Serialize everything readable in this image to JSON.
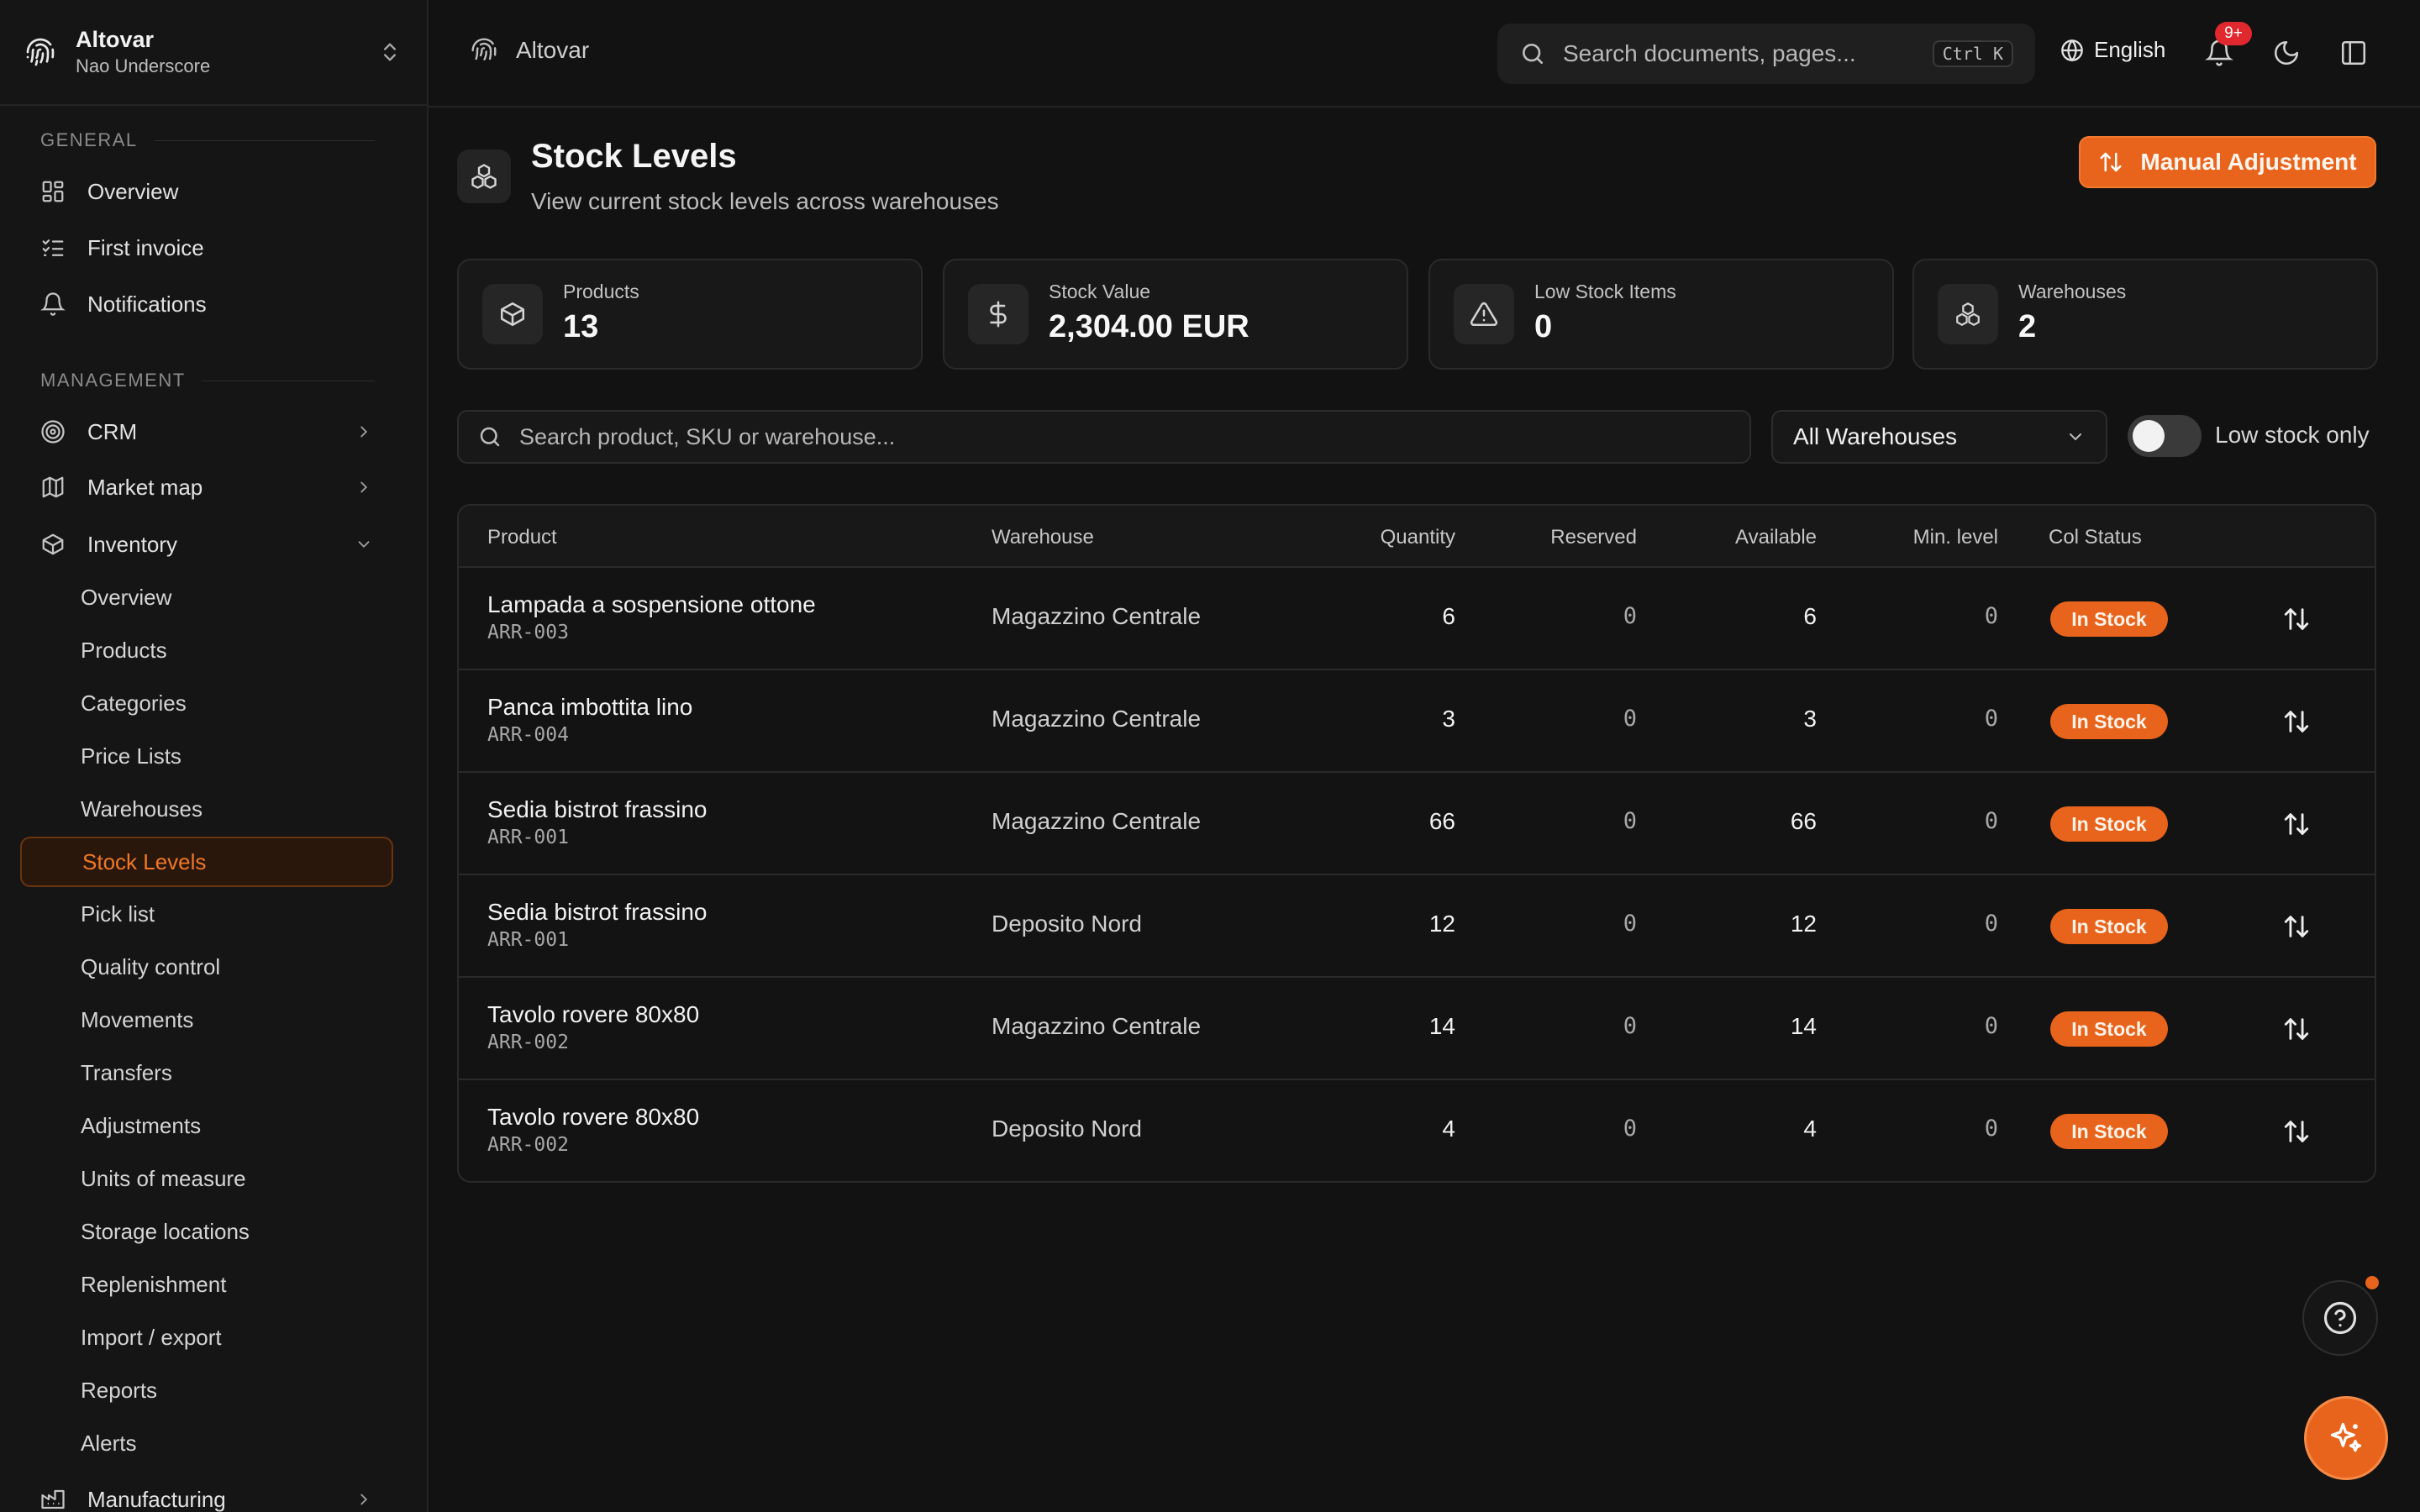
{
  "org": {
    "name": "Altovar",
    "user": "Nao Underscore"
  },
  "sidebar": {
    "general_label": "GENERAL",
    "general": [
      {
        "label": "Overview",
        "icon": "dashboard-icon"
      },
      {
        "label": "First invoice",
        "icon": "checklist-icon"
      },
      {
        "label": "Notifications",
        "icon": "bell-icon"
      }
    ],
    "management_label": "MANAGEMENT",
    "management": [
      {
        "label": "CRM",
        "icon": "target-icon"
      },
      {
        "label": "Market map",
        "icon": "map-icon"
      },
      {
        "label": "Inventory",
        "icon": "box-icon"
      }
    ],
    "inventory_sub": [
      "Overview",
      "Products",
      "Categories",
      "Price Lists",
      "Warehouses",
      "Stock Levels",
      "Pick list",
      "Quality control",
      "Movements",
      "Transfers",
      "Adjustments",
      "Units of measure",
      "Storage locations",
      "Replenishment",
      "Import / export",
      "Reports",
      "Alerts"
    ],
    "active_sub": "Stock Levels",
    "manufacturing": "Manufacturing"
  },
  "topbar": {
    "breadcrumb": "Altovar",
    "search_placeholder": "Search documents, pages...",
    "shortcut": "Ctrl K",
    "language": "English",
    "notification_badge": "9+"
  },
  "page": {
    "title": "Stock Levels",
    "subtitle": "View current stock levels across warehouses",
    "action": "Manual Adjustment"
  },
  "stats": [
    {
      "label": "Products",
      "value": "13",
      "icon": "package-icon"
    },
    {
      "label": "Stock Value",
      "value": "2,304.00 EUR",
      "icon": "dollar-icon"
    },
    {
      "label": "Low Stock Items",
      "value": "0",
      "icon": "warning-icon"
    },
    {
      "label": "Warehouses",
      "value": "2",
      "icon": "boxes-icon"
    }
  ],
  "filters": {
    "search_placeholder": "Search product, SKU or warehouse...",
    "warehouse": "All Warehouses",
    "low_stock_label": "Low stock only",
    "low_stock_on": false
  },
  "table": {
    "headers": [
      "Product",
      "Warehouse",
      "Quantity",
      "Reserved",
      "Available",
      "Min. level",
      "Col Status"
    ],
    "rows": [
      {
        "product": "Lampada a sospensione ottone",
        "sku": "ARR-003",
        "warehouse": "Magazzino Centrale",
        "quantity": "6",
        "reserved": "0",
        "available": "6",
        "min": "0",
        "status": "In Stock"
      },
      {
        "product": "Panca imbottita lino",
        "sku": "ARR-004",
        "warehouse": "Magazzino Centrale",
        "quantity": "3",
        "reserved": "0",
        "available": "3",
        "min": "0",
        "status": "In Stock"
      },
      {
        "product": "Sedia bistrot frassino",
        "sku": "ARR-001",
        "warehouse": "Magazzino Centrale",
        "quantity": "66",
        "reserved": "0",
        "available": "66",
        "min": "0",
        "status": "In Stock"
      },
      {
        "product": "Sedia bistrot frassino",
        "sku": "ARR-001",
        "warehouse": "Deposito Nord",
        "quantity": "12",
        "reserved": "0",
        "available": "12",
        "min": "0",
        "status": "In Stock"
      },
      {
        "product": "Tavolo rovere 80x80",
        "sku": "ARR-002",
        "warehouse": "Magazzino Centrale",
        "quantity": "14",
        "reserved": "0",
        "available": "14",
        "min": "0",
        "status": "In Stock"
      },
      {
        "product": "Tavolo rovere 80x80",
        "sku": "ARR-002",
        "warehouse": "Deposito Nord",
        "quantity": "4",
        "reserved": "0",
        "available": "4",
        "min": "0",
        "status": "In Stock"
      }
    ]
  },
  "colors": {
    "accent": "#e8641c",
    "background": "#121212",
    "badge_red": "#e0282e"
  }
}
